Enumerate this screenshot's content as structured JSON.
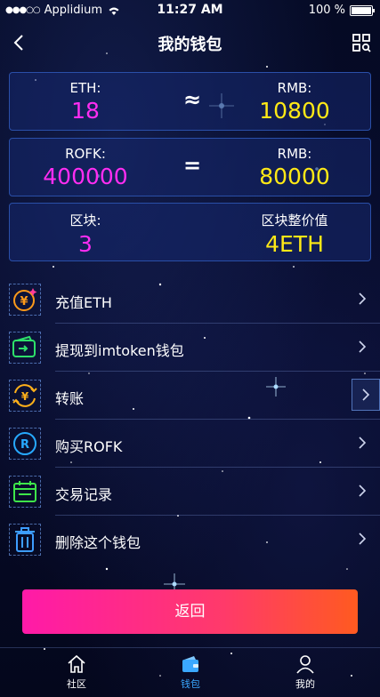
{
  "status_bar": {
    "carrier": "Applidium",
    "time": "11:27 AM",
    "battery": "100 %"
  },
  "header": {
    "title": "我的钱包"
  },
  "rates": [
    {
      "left_label": "ETH:",
      "left_value": "18",
      "operator": "≈",
      "right_label": "RMB:",
      "right_value": "10800"
    },
    {
      "left_label": "ROFK:",
      "left_value": "400000",
      "operator": "=",
      "right_label": "RMB:",
      "right_value": "80000"
    },
    {
      "left_label": "区块:",
      "left_value": "3",
      "operator": "",
      "right_label": "区块整价值",
      "right_value": "4ETH"
    }
  ],
  "menu": [
    {
      "label": "充值ETH",
      "icon": "recharge-icon",
      "color": "#ff9a1a"
    },
    {
      "label": "提现到imtoken钱包",
      "icon": "withdraw-wallet-icon",
      "color": "#2ee06a"
    },
    {
      "label": "转账",
      "icon": "transfer-icon",
      "color": "#ffb01a"
    },
    {
      "label": "购买ROFK",
      "icon": "buy-rofk-icon",
      "color": "#27a9ff"
    },
    {
      "label": "交易记录",
      "icon": "calendar-record-icon",
      "color": "#3ee64a"
    },
    {
      "label": "删除这个钱包",
      "icon": "trash-icon",
      "color": "#3d9dff"
    }
  ],
  "return_button": "返回",
  "tabs": [
    {
      "label": "社区",
      "icon": "home-icon"
    },
    {
      "label": "钱包",
      "icon": "wallet-icon",
      "active": true,
      "color": "#3aa8ff"
    },
    {
      "label": "我的",
      "icon": "user-icon"
    }
  ]
}
